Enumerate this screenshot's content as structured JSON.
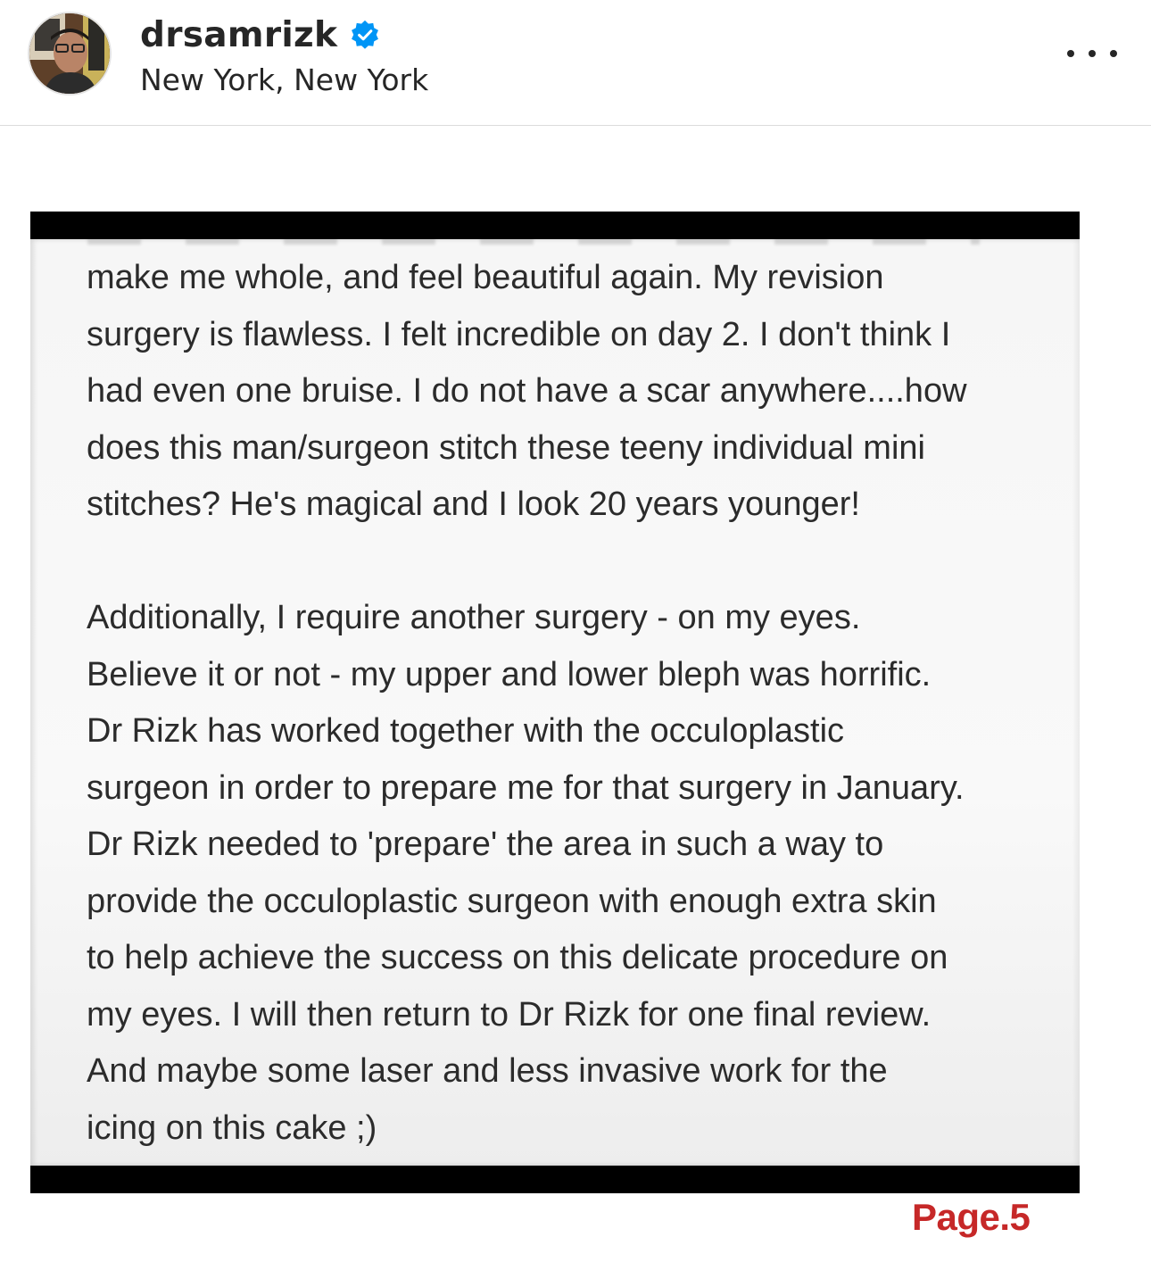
{
  "post": {
    "username": "drsamrizk",
    "verified_icon": "verified-badge-icon",
    "location": "New York, New York",
    "more_icon": "more-options-icon"
  },
  "image": {
    "paragraph1": [
      "make me whole, and feel beautiful again. My revision",
      "surgery is flawless. I felt incredible on day 2. I don't think I",
      "had even one bruise. I do not have a scar anywhere....how",
      "does this man/surgeon stitch these teeny individual mini",
      "stitches? He's magical and I look 20 years younger!"
    ],
    "paragraph2": [
      "Additionally, I require another surgery - on my eyes.",
      "Believe it or not - my upper and lower bleph was horrific.",
      "Dr Rizk has worked together with the occuloplastic",
      "surgeon in order to prepare me for that surgery in January.",
      "Dr Rizk needed to 'prepare' the area in such a way to",
      "provide the occuloplastic surgeon with enough extra skin",
      "to help achieve the success on this delicate procedure on",
      "my eyes. I will then return to Dr Rizk for one final review.",
      "And maybe some laser and less invasive work for the",
      "icing on this cake ;)"
    ],
    "page_label": "Page.5"
  },
  "colors": {
    "verified_blue": "#0095f6",
    "page_label_red": "#c62828",
    "text_dark": "#262626"
  }
}
